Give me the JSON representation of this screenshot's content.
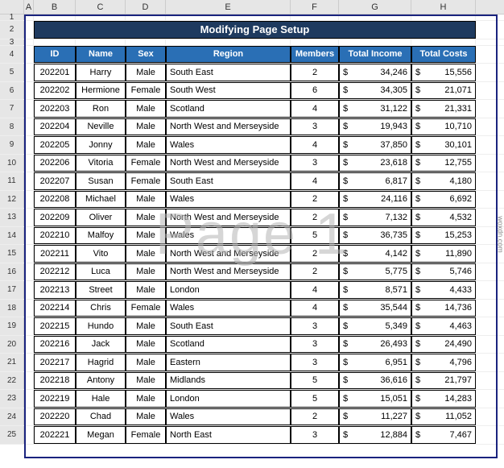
{
  "title": "Modifying Page Setup",
  "watermark": "Page 1",
  "attribution": "woxdn.com",
  "col_letters": [
    "A",
    "B",
    "C",
    "D",
    "E",
    "F",
    "G",
    "H"
  ],
  "row_numbers": [
    "1",
    "2",
    "3",
    "4",
    "5",
    "6",
    "7",
    "8",
    "9",
    "10",
    "11",
    "12",
    "13",
    "14",
    "15",
    "16",
    "17",
    "18",
    "19",
    "20",
    "21",
    "22",
    "23",
    "24",
    "25"
  ],
  "headers": {
    "id": "ID",
    "name": "Name",
    "sex": "Sex",
    "region": "Region",
    "members": "Members",
    "total_income": "Total Income",
    "total_costs": "Total Costs"
  },
  "currency_symbol": "$",
  "chart_data": {
    "type": "table",
    "title": "Modifying Page Setup",
    "columns": [
      "ID",
      "Name",
      "Sex",
      "Region",
      "Members",
      "Total Income",
      "Total Costs"
    ],
    "rows": [
      {
        "id": "202201",
        "name": "Harry",
        "sex": "Male",
        "region": "South East",
        "members": "2",
        "income": "34,246",
        "costs": "15,556"
      },
      {
        "id": "202202",
        "name": "Hermione",
        "sex": "Female",
        "region": "South West",
        "members": "6",
        "income": "34,305",
        "costs": "21,071"
      },
      {
        "id": "202203",
        "name": "Ron",
        "sex": "Male",
        "region": "Scotland",
        "members": "4",
        "income": "31,122",
        "costs": "21,331"
      },
      {
        "id": "202204",
        "name": "Neville",
        "sex": "Male",
        "region": "North West and Merseyside",
        "members": "3",
        "income": "19,943",
        "costs": "10,710"
      },
      {
        "id": "202205",
        "name": "Jonny",
        "sex": "Male",
        "region": "Wales",
        "members": "4",
        "income": "37,850",
        "costs": "30,101"
      },
      {
        "id": "202206",
        "name": "Vitoria",
        "sex": "Female",
        "region": "North West and Merseyside",
        "members": "3",
        "income": "23,618",
        "costs": "12,755"
      },
      {
        "id": "202207",
        "name": "Susan",
        "sex": "Female",
        "region": "South East",
        "members": "4",
        "income": "6,817",
        "costs": "4,180"
      },
      {
        "id": "202208",
        "name": "Michael",
        "sex": "Male",
        "region": "Wales",
        "members": "2",
        "income": "24,116",
        "costs": "6,692"
      },
      {
        "id": "202209",
        "name": "Oliver",
        "sex": "Male",
        "region": "North West and Merseyside",
        "members": "2",
        "income": "7,132",
        "costs": "4,532"
      },
      {
        "id": "202210",
        "name": "Malfoy",
        "sex": "Male",
        "region": "Wales",
        "members": "5",
        "income": "36,735",
        "costs": "15,253"
      },
      {
        "id": "202211",
        "name": "Vito",
        "sex": "Male",
        "region": "North West and Merseyside",
        "members": "2",
        "income": "4,142",
        "costs": "11,890"
      },
      {
        "id": "202212",
        "name": "Luca",
        "sex": "Male",
        "region": "North West and Merseyside",
        "members": "2",
        "income": "5,775",
        "costs": "5,746"
      },
      {
        "id": "202213",
        "name": "Street",
        "sex": "Male",
        "region": "London",
        "members": "4",
        "income": "8,571",
        "costs": "4,433"
      },
      {
        "id": "202214",
        "name": "Chris",
        "sex": "Female",
        "region": "Wales",
        "members": "4",
        "income": "35,544",
        "costs": "14,736"
      },
      {
        "id": "202215",
        "name": "Hundo",
        "sex": "Male",
        "region": "South East",
        "members": "3",
        "income": "5,349",
        "costs": "4,463"
      },
      {
        "id": "202216",
        "name": "Jack",
        "sex": "Male",
        "region": "Scotland",
        "members": "3",
        "income": "26,493",
        "costs": "24,490"
      },
      {
        "id": "202217",
        "name": "Hagrid",
        "sex": "Male",
        "region": "Eastern",
        "members": "3",
        "income": "6,951",
        "costs": "4,796"
      },
      {
        "id": "202218",
        "name": "Antony",
        "sex": "Male",
        "region": "Midlands",
        "members": "5",
        "income": "36,616",
        "costs": "21,797"
      },
      {
        "id": "202219",
        "name": "Hale",
        "sex": "Male",
        "region": "London",
        "members": "5",
        "income": "15,051",
        "costs": "14,283"
      },
      {
        "id": "202220",
        "name": "Chad",
        "sex": "Male",
        "region": "Wales",
        "members": "2",
        "income": "11,227",
        "costs": "11,052"
      },
      {
        "id": "202221",
        "name": "Megan",
        "sex": "Female",
        "region": "North East",
        "members": "3",
        "income": "12,884",
        "costs": "7,467"
      }
    ]
  }
}
